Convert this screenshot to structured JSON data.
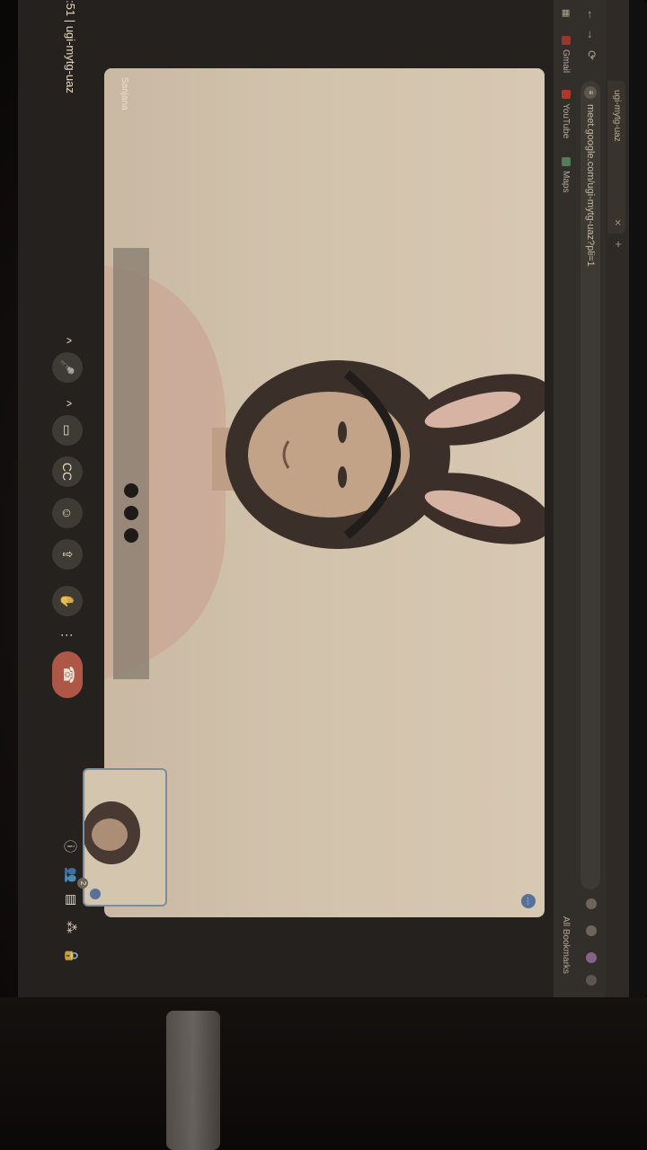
{
  "browser": {
    "tab_title": "ugi-mytg-uaz",
    "tab_close": "✕",
    "new_tab": "+",
    "url": "meet.google.com/ugi-mytg-uaz?pli=1",
    "nav_back": "←",
    "nav_forward": "→",
    "nav_reload": "⟳",
    "bookmarks": [
      {
        "label": "Gmail",
        "color": "#c5221f"
      },
      {
        "label": "YouTube",
        "color": "#e62117"
      },
      {
        "label": "Maps",
        "color": "#3c8a5a"
      }
    ],
    "apps_icon": "apps-grid-icon",
    "all_bookmarks": "All Bookmarks"
  },
  "meet": {
    "participant_name": "Sanjana",
    "more_options": "⋯",
    "meeting_code_time": ":51",
    "meeting_code_separator": "|",
    "meeting_code": "ugi-mytg-uaz",
    "controls": {
      "mic": "🎤",
      "chevron": "^",
      "camera": "▭",
      "captions": "CC",
      "emoji": "☺",
      "present": "⇪",
      "hand": "✋",
      "more": "⋮",
      "end_call": "☎"
    },
    "right_controls": {
      "info": "ⓘ",
      "people": "👥",
      "people_count": "2",
      "chat": "▤",
      "activities": "⁂",
      "lock": "🔒"
    }
  },
  "colors": {
    "end_call": "#d9463b",
    "accent_blue": "#3f74c8"
  }
}
